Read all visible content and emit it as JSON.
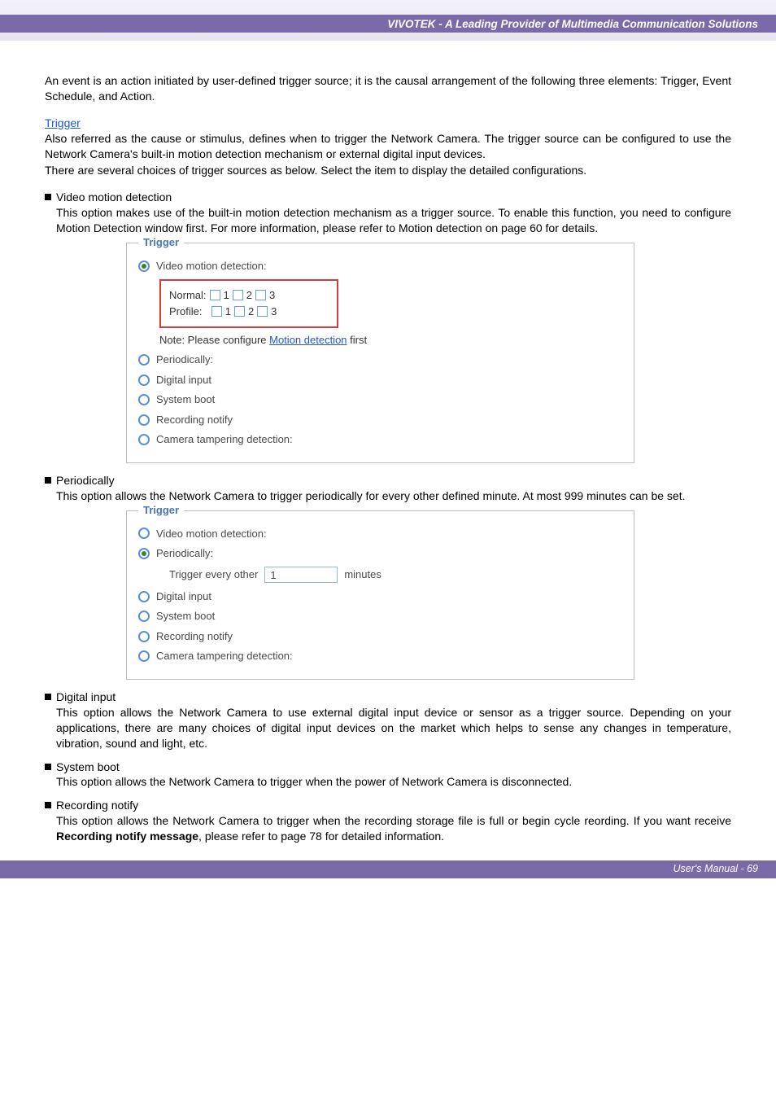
{
  "header": {
    "brandline": "VIVOTEK - A Leading Provider of Multimedia Communication Solutions"
  },
  "intro": "An event is an action initiated by user-defined trigger source; it is the causal arrangement of the following three elements: Trigger, Event Schedule, and Action.",
  "trigger_section": {
    "heading": "Trigger",
    "desc1": "Also referred as the cause or stimulus, defines when to trigger the Network Camera. The trigger source can be configured to use the Network Camera's built-in motion detection mechanism or external digital input devices.",
    "desc2": "There are several choices of trigger sources as below. Select the item to display the detailed configurations."
  },
  "bullets": {
    "vmd": {
      "title": "Video motion detection",
      "desc": "This option makes use of the built-in motion detection mechanism as a trigger source. To enable this function, you need to configure Motion Detection window first. For more information, please refer to Motion detection on page 60 for details."
    },
    "periodic": {
      "title": "Periodically",
      "desc": "This option allows the Network Camera to trigger periodically for every other defined minute. At most 999 minutes can be set."
    },
    "digital": {
      "title": "Digital input",
      "desc": "This option allows the Network Camera to use external digital input device or sensor as a trigger source. Depending on your applications, there are many choices of digital input devices on the market which helps to sense any changes in temperature, vibration, sound and light, etc."
    },
    "sysboot": {
      "title": "System boot",
      "desc": "This option allows the Network Camera to trigger when the power of Network Camera is disconnected."
    },
    "recnotify": {
      "title": "Recording notify",
      "desc_pre": "This option allows the Network Camera to trigger when the recording storage file is full or begin cycle reording. If you want receive ",
      "desc_bold": "Recording notify message",
      "desc_post": ", please refer to page 78 for detailed information."
    }
  },
  "panel1": {
    "legend": "Trigger",
    "r_vmd": "Video motion detection:",
    "normal_label": "Normal:",
    "profile_label": "Profile:",
    "note_pre": "Note: Please configure ",
    "note_link": "Motion detection",
    "note_post": " first",
    "r_period": "Periodically:",
    "r_digital": "Digital input",
    "r_sysboot": "System boot",
    "r_rec": "Recording notify",
    "r_tamper": "Camera tampering detection:"
  },
  "panel2": {
    "legend": "Trigger",
    "r_vmd": "Video motion detection:",
    "r_period": "Periodically:",
    "every_label": "Trigger every other",
    "every_value": "1",
    "every_unit": "minutes",
    "r_digital": "Digital input",
    "r_sysboot": "System boot",
    "r_rec": "Recording notify",
    "r_tamper": "Camera tampering detection:"
  },
  "nums": {
    "n1": "1",
    "n2": "2",
    "n3": "3"
  },
  "footer": {
    "text": "User's Manual - 69"
  }
}
